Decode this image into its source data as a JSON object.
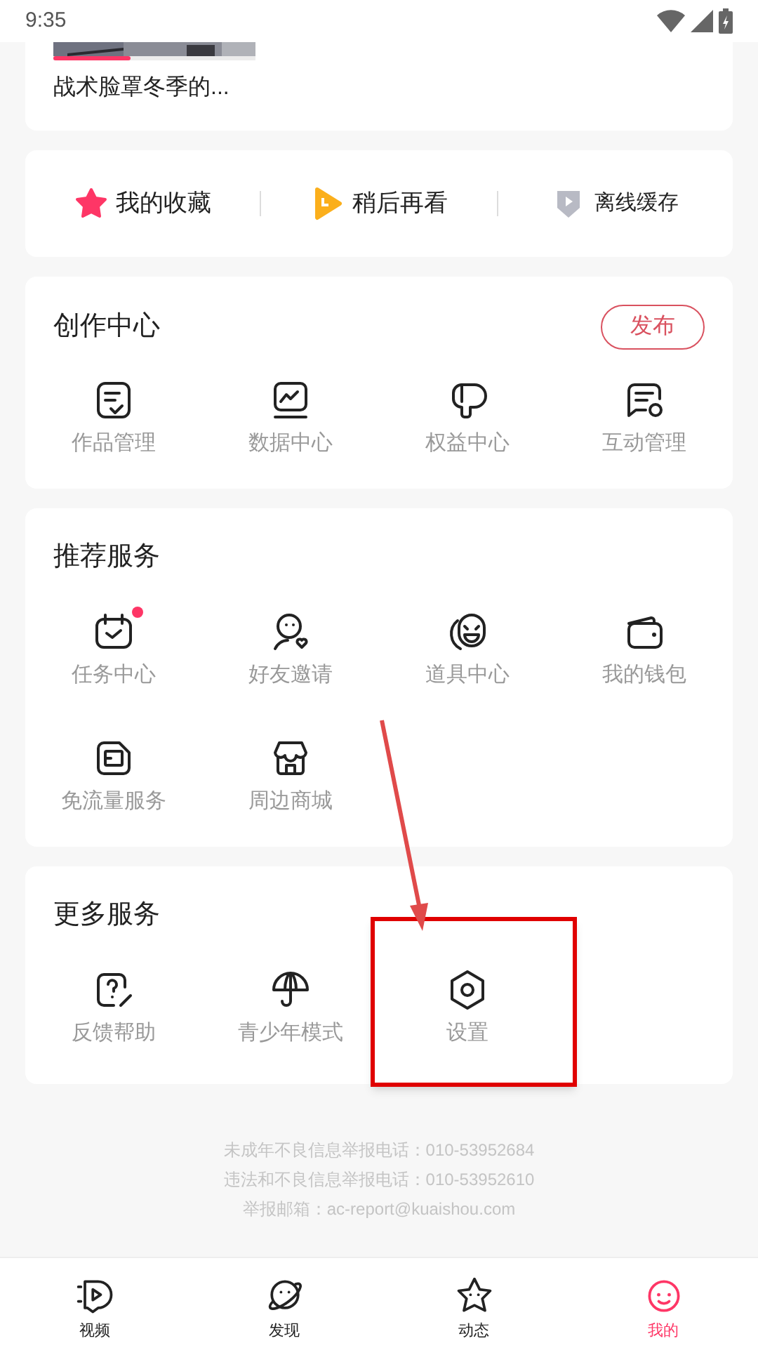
{
  "status_bar": {
    "time": "9:35"
  },
  "recent": {
    "progress": {
      "level": 0.38
    },
    "title": "战术脸罩冬季的..."
  },
  "shortcuts": [
    {
      "kind": "star",
      "label": "我的收藏"
    },
    {
      "kind": "later",
      "label": "稍后再看"
    },
    {
      "kind": "download",
      "label": "离线缓存"
    }
  ],
  "creation_center": {
    "title": "创作中心",
    "publish_button": "发布",
    "items": [
      {
        "kind": "works",
        "label": "作品管理"
      },
      {
        "kind": "data",
        "label": "数据中心"
      },
      {
        "kind": "rights",
        "label": "权益中心"
      },
      {
        "kind": "interact",
        "label": "互动管理"
      }
    ]
  },
  "recommended": {
    "title": "推荐服务",
    "items": [
      {
        "kind": "task",
        "label": "任务中心",
        "badge": true
      },
      {
        "kind": "invite",
        "label": "好友邀请",
        "badge": false
      },
      {
        "kind": "props",
        "label": "道具中心",
        "badge": false
      },
      {
        "kind": "wallet",
        "label": "我的钱包",
        "badge": false
      },
      {
        "kind": "free",
        "label": "免流量服务",
        "badge": false
      },
      {
        "kind": "shop",
        "label": "周边商城",
        "badge": false
      }
    ]
  },
  "more_services": {
    "title": "更多服务",
    "items": [
      {
        "kind": "help",
        "label": "反馈帮助",
        "highlighted": false
      },
      {
        "kind": "teen",
        "label": "青少年模式",
        "highlighted": false
      },
      {
        "kind": "settings",
        "label": "设置",
        "highlighted": true
      }
    ]
  },
  "footer": [
    "未成年不良信息举报电话：010-53952684",
    "违法和不良信息举报电话：010-53952610",
    "举报邮箱：ac-report@kuaishou.com"
  ],
  "tab_bar": [
    {
      "kind": "video",
      "label": "视频",
      "selected": false
    },
    {
      "kind": "discover",
      "label": "发现",
      "selected": false
    },
    {
      "kind": "feed",
      "label": "动态",
      "selected": false
    },
    {
      "kind": "me",
      "label": "我的",
      "selected": true
    }
  ]
}
